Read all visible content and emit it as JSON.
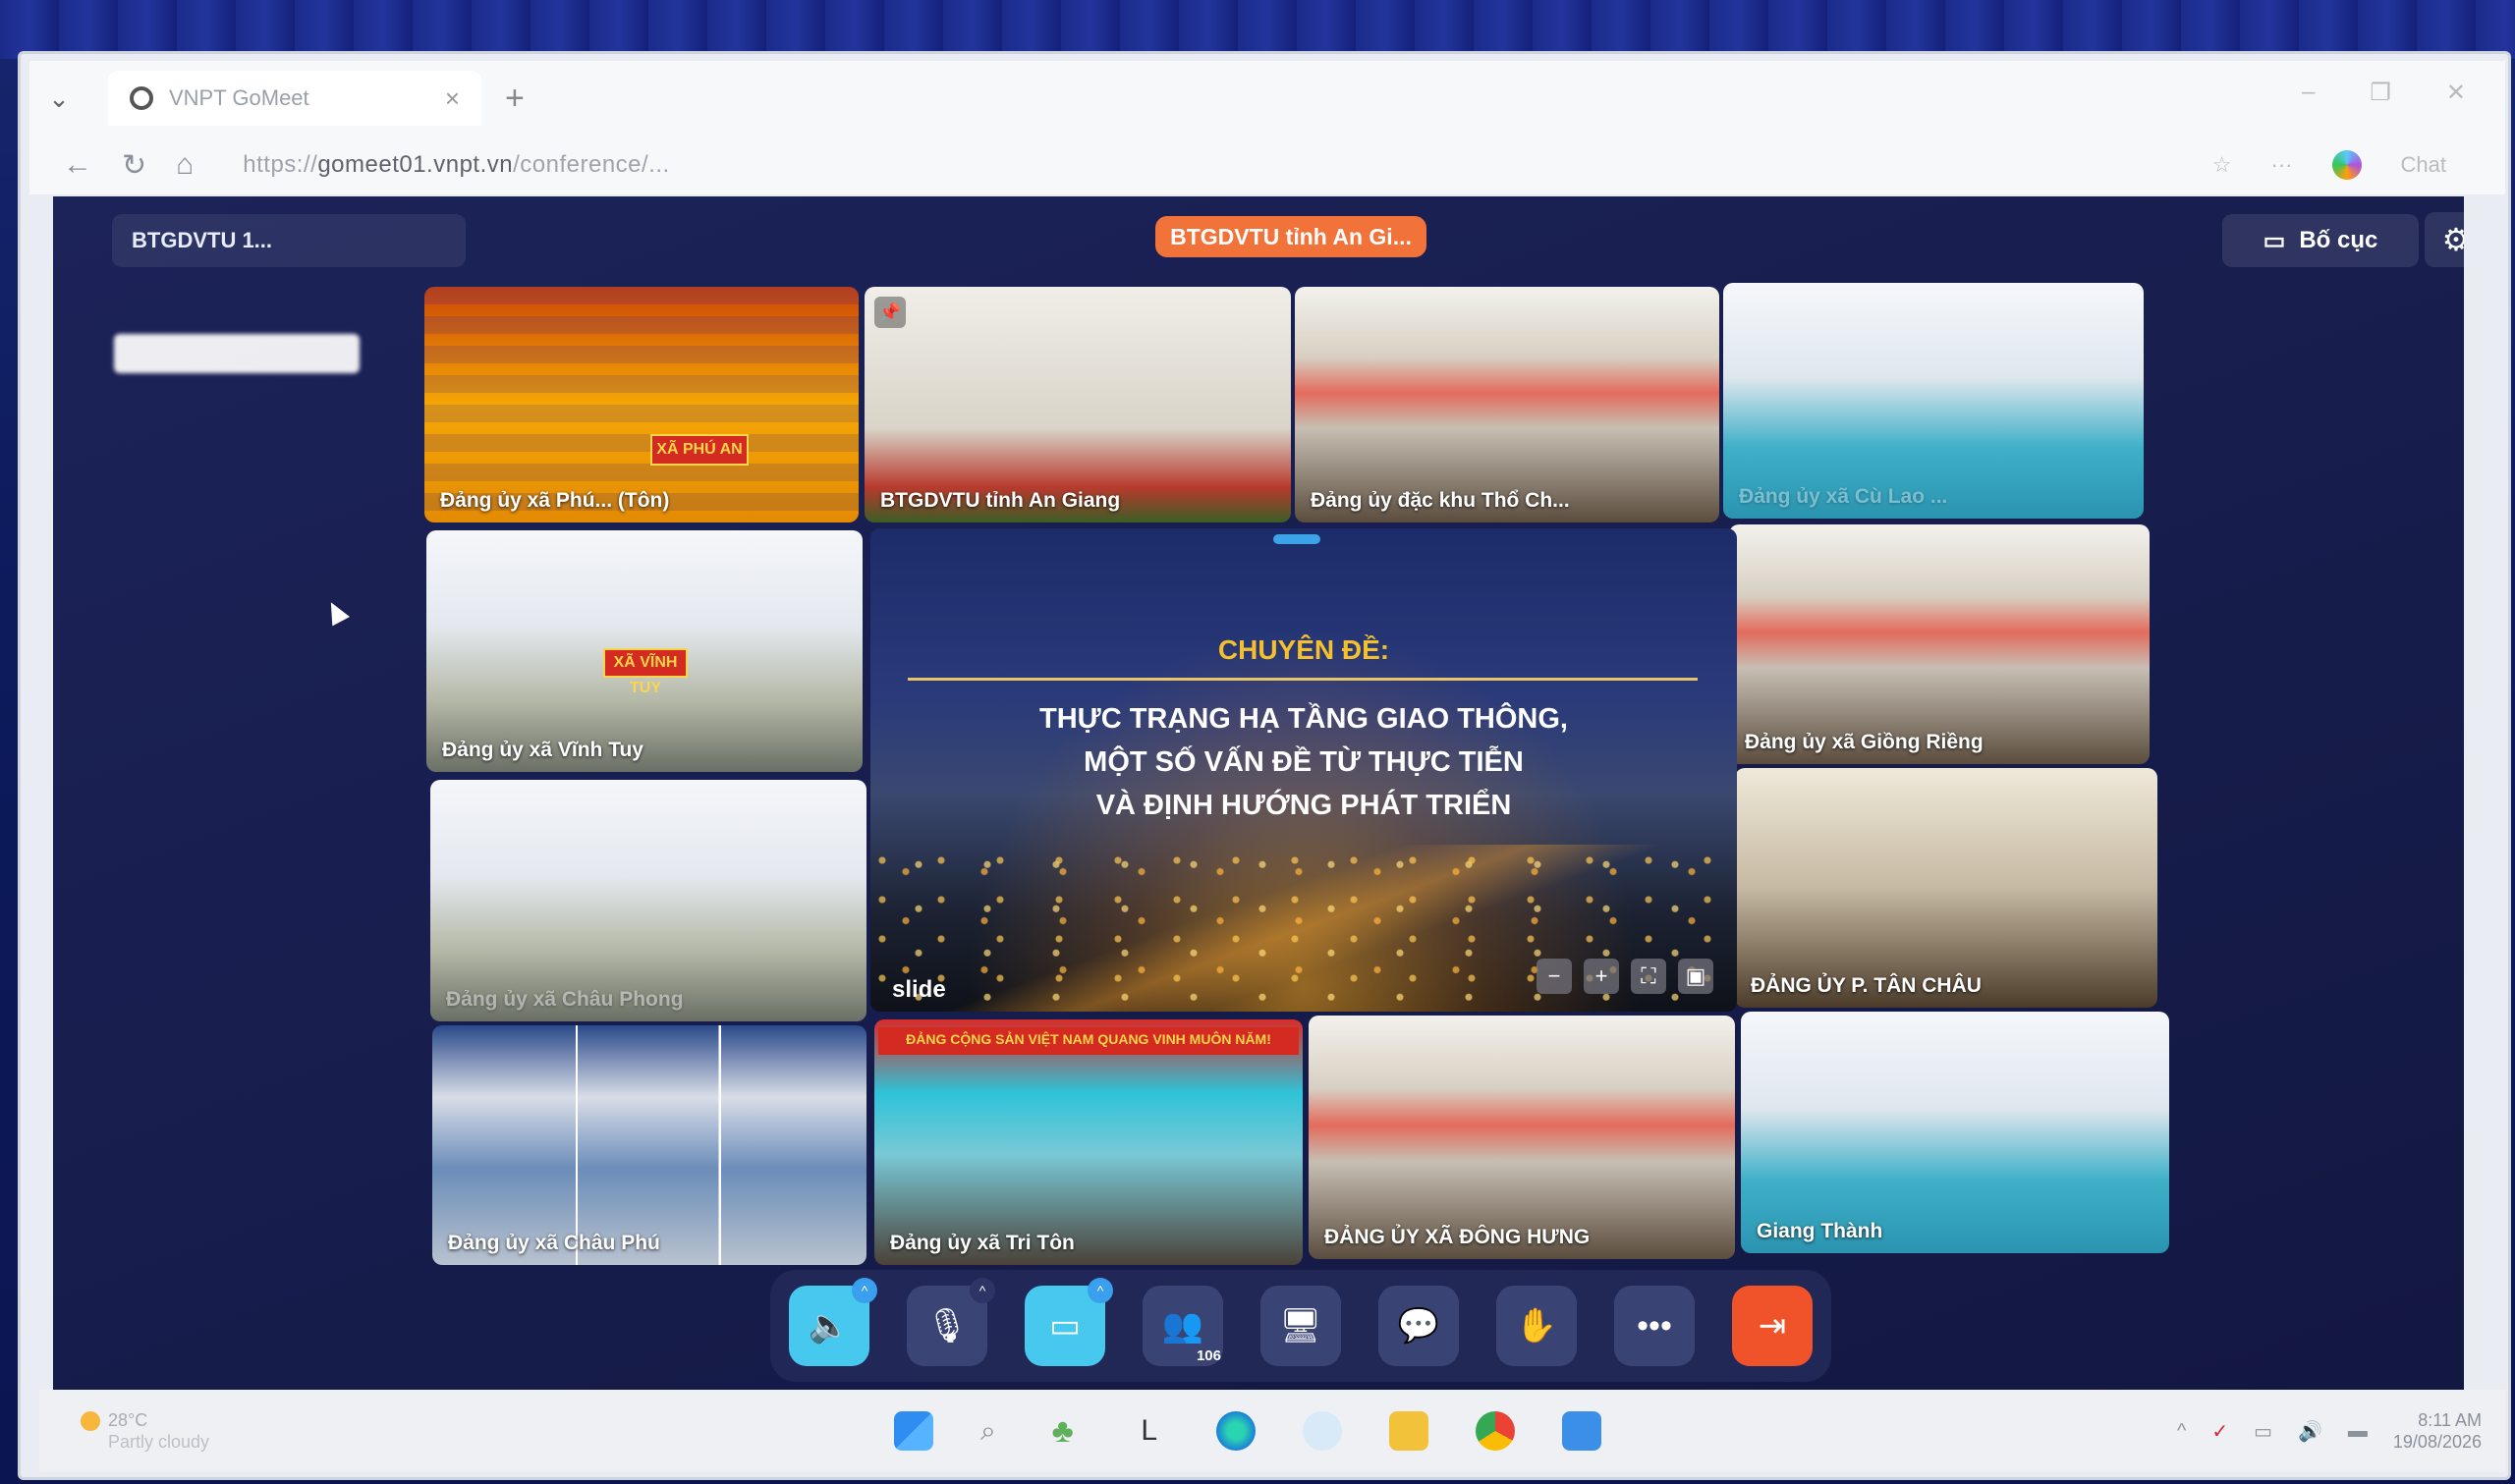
{
  "browser": {
    "tab_title": "VNPT GoMeet",
    "url_host": "gomeet01.vnpt.vn",
    "url_prefix": "https://",
    "url_rest": "/conference/...",
    "profile_label": "Chat"
  },
  "meeting": {
    "title": "BTGDVTU 1...",
    "active_speaker": "BTGDVTU tỉnh An Gi...",
    "layout_label": "Bố cục"
  },
  "tiles": [
    {
      "label": "Đảng ủy xã Phú... (Tôn)"
    },
    {
      "label": "BTGDVTU tỉnh An Giang"
    },
    {
      "label": "Đảng ủy đặc khu Thổ Ch..."
    },
    {
      "label": "Đảng ủy xã Cù Lao ..."
    },
    {
      "label": "Đảng ủy xã Vĩnh Tuy"
    },
    {
      "label": "Đảng ủy xã Giồng Riềng"
    },
    {
      "label": "Đảng ủy xã Châu Phong"
    },
    {
      "label": "ĐẢNG ỦY P. TÂN CHÂU"
    },
    {
      "label": "Đảng ủy xã Châu Phú"
    },
    {
      "label": "Đảng ủy xã Tri Tôn"
    },
    {
      "label": "ĐẢNG ỦY XÃ ĐÔNG HƯNG"
    },
    {
      "label": "Giang Thành"
    }
  ],
  "banners": {
    "xa_phu_an": "XÃ PHÚ AN",
    "vinh_tuy": "XÃ VĨNH TUY",
    "party_slogan": "ĐẢNG CỘNG SẢN VIỆT NAM QUANG VINH MUÔN NĂM!"
  },
  "slide": {
    "heading": "CHUYÊN ĐỀ:",
    "line1": "THỰC TRẠNG HẠ TẦNG GIAO THÔNG,",
    "line2": "MỘT SỐ VẤN ĐỀ TỪ THỰC TIỄN",
    "line3": "VÀ ĐỊNH HƯỚNG PHÁT TRIỂN",
    "label": "slide"
  },
  "toolbar": {
    "participants_count": "106"
  },
  "taskbar": {
    "temperature": "28°C",
    "weather_desc": "Partly cloudy",
    "time": "8:11 AM",
    "date": "19/08/2026"
  }
}
